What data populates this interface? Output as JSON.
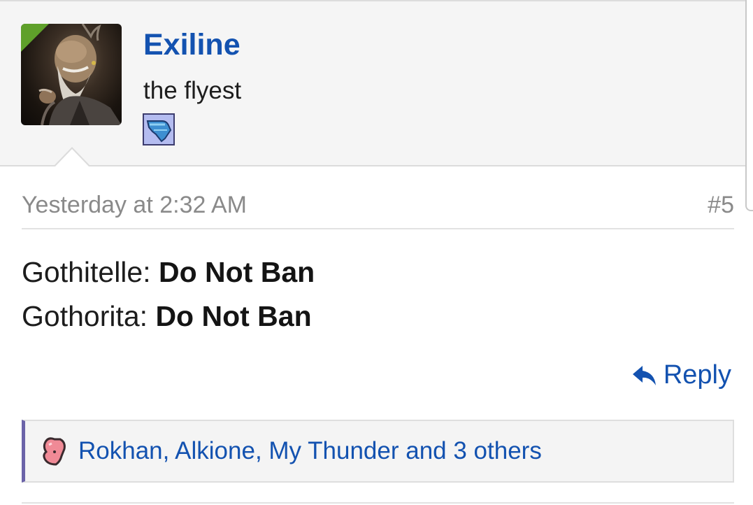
{
  "user": {
    "name": "Exiline",
    "title": "the flyest",
    "avatar_icon": "avatar-elder-portrait",
    "badge_icon": "wing-badge-icon",
    "accent_color": "#1352b0",
    "online_flag_color": "#5fa02a"
  },
  "post": {
    "date": "Yesterday at 2:32 AM",
    "number": "#5",
    "lines": [
      {
        "label": "Gothitelle: ",
        "value": "Do Not Ban"
      },
      {
        "label": "Gothorita: ",
        "value": "Do Not Ban"
      }
    ]
  },
  "actions": {
    "reply_label": "Reply",
    "reply_icon": "reply-arrow-icon"
  },
  "likes": {
    "text": "Rokhan, Alkione, My Thunder and 3 others",
    "icon": "heart-icon",
    "bar_accent": "#6b63a8"
  }
}
